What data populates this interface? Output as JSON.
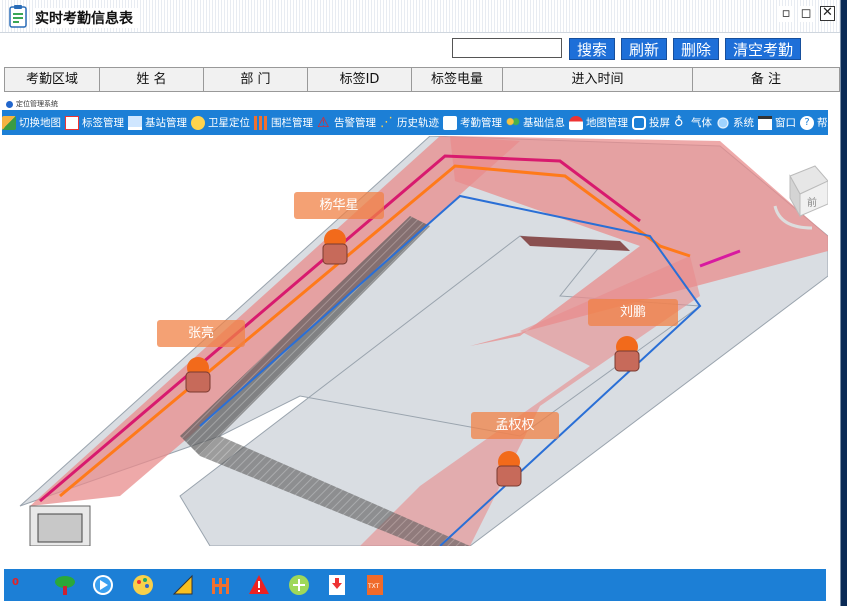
{
  "window": {
    "title": "实时考勤信息表"
  },
  "toolbar": {
    "search_value": "",
    "search_label": "搜索",
    "refresh_label": "刷新",
    "delete_label": "删除",
    "clear_label": "清空考勤"
  },
  "table": {
    "columns": [
      "考勤区域",
      "姓 名",
      "部 门",
      "标签ID",
      "标签电量",
      "进入时间",
      "备 注"
    ]
  },
  "map": {
    "system_label": "定位管理系统",
    "menu": [
      {
        "label": "切换地图",
        "icon": "switch-map-icon"
      },
      {
        "label": "标签管理",
        "icon": "tag-icon"
      },
      {
        "label": "基站管理",
        "icon": "base-station-icon"
      },
      {
        "label": "卫星定位",
        "icon": "satellite-icon"
      },
      {
        "label": "围栏管理",
        "icon": "fence-icon"
      },
      {
        "label": "告警管理",
        "icon": "warning-icon"
      },
      {
        "label": "历史轨迹",
        "icon": "track-icon"
      },
      {
        "label": "考勤管理",
        "icon": "attendance-icon"
      },
      {
        "label": "基础信息",
        "icon": "people-icon"
      },
      {
        "label": "地图管理",
        "icon": "map-icon"
      },
      {
        "label": "投屏",
        "icon": "cast-icon"
      },
      {
        "label": "气体",
        "icon": "gas-icon"
      },
      {
        "label": "系统",
        "icon": "system-icon"
      },
      {
        "label": "窗口",
        "icon": "window-icon"
      },
      {
        "label": "帮助",
        "icon": "help-icon"
      }
    ],
    "workers": [
      {
        "name": "杨华星"
      },
      {
        "name": "张亮"
      },
      {
        "name": "刘鹏"
      },
      {
        "name": "孟权权"
      }
    ],
    "compass_label": "前"
  },
  "bottom": {
    "count": "0",
    "icons": [
      "tree-icon",
      "play-icon",
      "palette-icon",
      "ruler-icon",
      "fence-icon",
      "warning-icon",
      "add-icon",
      "download-icon",
      "txt-export-icon"
    ]
  },
  "colors": {
    "accent": "#1c7fd6",
    "zone": "#e88080",
    "tag": "#f08246"
  }
}
